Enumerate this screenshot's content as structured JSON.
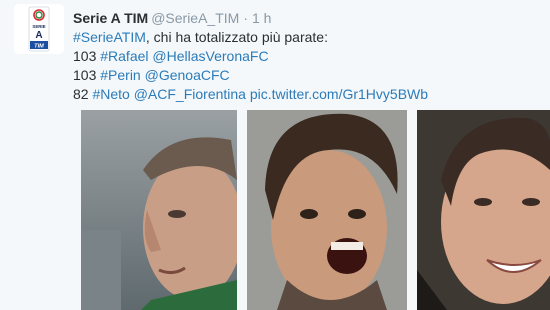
{
  "tweet": {
    "author_name": "Serie A TIM",
    "author_handle": "@SerieA_TIM",
    "separator": "·",
    "time": "1 h",
    "logo_text": {
      "top": "SERIE",
      "middle": "A",
      "bottom": "TIM"
    },
    "lines": [
      [
        {
          "text": "#SerieATIM",
          "link": true
        },
        {
          "text": ", chi ha totalizzato più parate:",
          "link": false
        }
      ],
      [
        {
          "text": "103 ",
          "link": false
        },
        {
          "text": "#Rafael",
          "link": true
        },
        {
          "text": " ",
          "link": false
        },
        {
          "text": "@HellasVeronaFC",
          "link": true
        }
      ],
      [
        {
          "text": "103 ",
          "link": false
        },
        {
          "text": "#Perin",
          "link": true
        },
        {
          "text": " ",
          "link": false
        },
        {
          "text": "@GenoaCFC",
          "link": true
        }
      ],
      [
        {
          "text": "82 ",
          "link": false
        },
        {
          "text": "#Neto",
          "link": true
        },
        {
          "text": " ",
          "link": false
        },
        {
          "text": "@ACF_Fiorentina",
          "link": true
        },
        {
          "text": " ",
          "link": false
        },
        {
          "text": "pic.twitter.com/Gr1Hvy5BWb",
          "link": true
        }
      ]
    ]
  },
  "colors": {
    "link": "#2b7bb9",
    "muted": "#8899a6",
    "text": "#292f33",
    "background": "#f5f8fa"
  }
}
